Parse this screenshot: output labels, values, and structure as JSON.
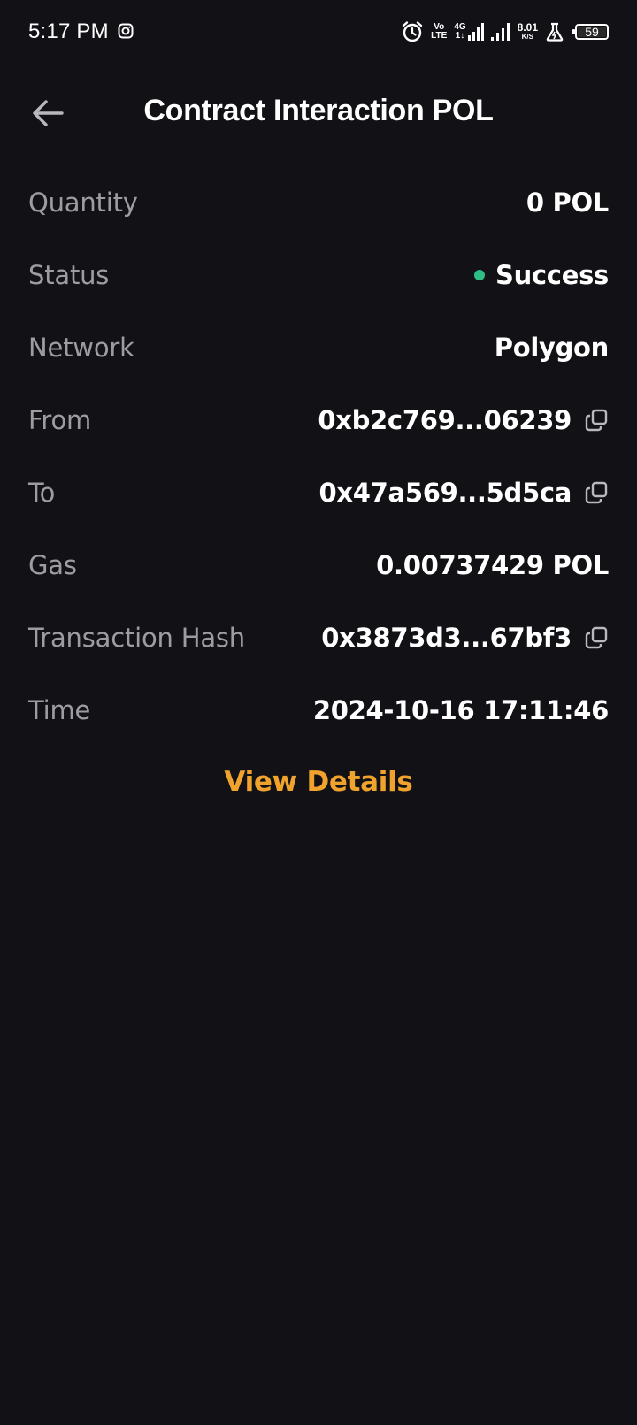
{
  "status_bar": {
    "time": "5:17 PM",
    "volte_top": "Vo",
    "volte_bottom": "LTE",
    "net_top": "4G",
    "net_bottom": "1↓",
    "speed_value": "8.01",
    "speed_unit": "K/S",
    "battery_level": "59"
  },
  "header": {
    "title": "Contract Interaction POL"
  },
  "details": {
    "quantity": {
      "label": "Quantity",
      "value": "0 POL"
    },
    "status": {
      "label": "Status",
      "value": "Success",
      "color": "#2ebd85"
    },
    "network": {
      "label": "Network",
      "value": "Polygon"
    },
    "from": {
      "label": "From",
      "value": "0xb2c769...06239"
    },
    "to": {
      "label": "To",
      "value": "0x47a569...5d5ca"
    },
    "gas": {
      "label": "Gas",
      "value": "0.00737429 POL"
    },
    "tx_hash": {
      "label": "Transaction Hash",
      "value": "0x3873d3...67bf3"
    },
    "time": {
      "label": "Time",
      "value": "2024-10-16 17:11:46"
    }
  },
  "view_details_label": "View Details",
  "colors": {
    "background": "#121115",
    "label": "#9c9ca3",
    "accent": "#f0a32c",
    "success": "#2ebd85"
  }
}
